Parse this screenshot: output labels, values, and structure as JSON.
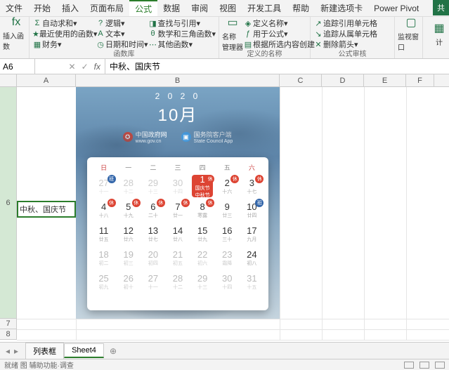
{
  "menubar": {
    "items": [
      "文件",
      "开始",
      "插入",
      "页面布局",
      "公式",
      "数据",
      "审阅",
      "视图",
      "开发工具",
      "帮助",
      "新建选项卡",
      "Power Pivot"
    ],
    "active_index": 4,
    "share": "共"
  },
  "ribbon": {
    "insert_fn": {
      "icon": "fx",
      "label": "插入函数"
    },
    "lib": {
      "autosum": "自动求和",
      "recent": "最近使用的函数",
      "financial": "财务",
      "logical": "逻辑",
      "text": "文本",
      "datetime": "日期和时间",
      "lookup": "查找与引用",
      "math": "数学和三角函数",
      "more": "其他函数",
      "group_label": "函数库"
    },
    "names": {
      "mgr": "名称\n管理器",
      "define": "定义名称",
      "usein": "用于公式",
      "create": "根据所选内容创建",
      "group_label": "定义的名称"
    },
    "audit": {
      "trace_prec": "追踪引用单元格",
      "trace_dep": "追踪从属单元格",
      "remove": "删除箭头",
      "group_label": "公式审核"
    },
    "watch": {
      "label": "监视窗口"
    },
    "calc": {
      "label": "计"
    }
  },
  "namebox": {
    "value": "A6"
  },
  "formula": {
    "value": "中秋、国庆节"
  },
  "columns": [
    "A",
    "B",
    "C",
    "D",
    "E",
    "F"
  ],
  "rows_visible": [
    6,
    7,
    8
  ],
  "cell_A6": "中秋、国庆节",
  "calendar": {
    "year": "2 0 2 0",
    "month": "10月",
    "brand1": {
      "name": "中国政府网",
      "sub": "www.gov.cn"
    },
    "brand2": {
      "name": "国务院客户端",
      "sub": "State Council App"
    },
    "dow": [
      "日",
      "一",
      "二",
      "三",
      "四",
      "五",
      "六"
    ],
    "weeks": [
      [
        {
          "n": "27",
          "s": "十一",
          "o": true,
          "b": "work"
        },
        {
          "n": "28",
          "s": "十二",
          "o": true
        },
        {
          "n": "29",
          "s": "十三",
          "o": true
        },
        {
          "n": "30",
          "s": "十四",
          "o": true
        },
        {
          "n": "1",
          "s": "国庆节",
          "hl": true,
          "b": "rest",
          "s2": "中秋节"
        },
        {
          "n": "2",
          "s": "十六",
          "b": "rest"
        },
        {
          "n": "3",
          "s": "十七",
          "b": "rest"
        }
      ],
      [
        {
          "n": "4",
          "s": "十八",
          "b": "rest"
        },
        {
          "n": "5",
          "s": "十九",
          "b": "rest"
        },
        {
          "n": "6",
          "s": "二十",
          "b": "rest"
        },
        {
          "n": "7",
          "s": "廿一",
          "b": "rest"
        },
        {
          "n": "8",
          "s": "寒露",
          "b": "rest"
        },
        {
          "n": "9",
          "s": "廿三"
        },
        {
          "n": "10",
          "s": "廿四",
          "b": "work"
        }
      ],
      [
        {
          "n": "11",
          "s": "廿五"
        },
        {
          "n": "12",
          "s": "廿六"
        },
        {
          "n": "13",
          "s": "廿七"
        },
        {
          "n": "14",
          "s": "廿八"
        },
        {
          "n": "15",
          "s": "廿九"
        },
        {
          "n": "16",
          "s": "三十"
        },
        {
          "n": "17",
          "s": "九月"
        }
      ],
      [
        {
          "n": "18",
          "s": "初二",
          "g": true
        },
        {
          "n": "19",
          "s": "初三",
          "g": true
        },
        {
          "n": "20",
          "s": "初四",
          "g": true
        },
        {
          "n": "21",
          "s": "初五",
          "g": true
        },
        {
          "n": "22",
          "s": "初六",
          "g": true
        },
        {
          "n": "23",
          "s": "霜降",
          "g": true
        },
        {
          "n": "24",
          "s": "初八"
        }
      ],
      [
        {
          "n": "25",
          "s": "初九",
          "g": true
        },
        {
          "n": "26",
          "s": "初十",
          "g": true
        },
        {
          "n": "27",
          "s": "十一",
          "g": true
        },
        {
          "n": "28",
          "s": "十二",
          "g": true
        },
        {
          "n": "29",
          "s": "十三",
          "g": true
        },
        {
          "n": "30",
          "s": "十四",
          "g": true
        },
        {
          "n": "31",
          "s": "十五",
          "g": true
        }
      ]
    ],
    "badge_rest": "休",
    "badge_work": "班"
  },
  "tabs": {
    "items": [
      "列表框",
      "Sheet4"
    ],
    "active_index": 1
  },
  "status": {
    "left": "就绪    图    辅助功能·调查"
  }
}
